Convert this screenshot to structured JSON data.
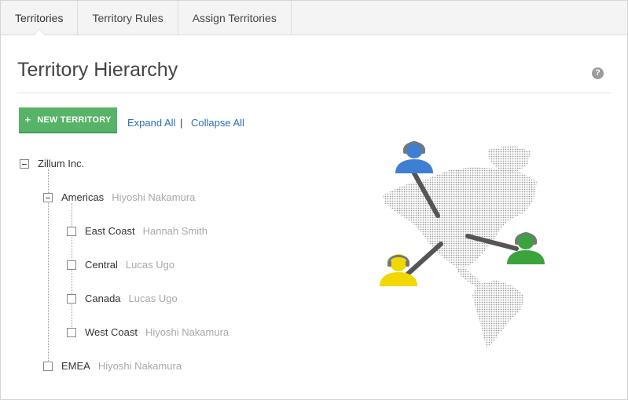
{
  "tabs": [
    {
      "label": "Territories",
      "active": true
    },
    {
      "label": "Territory Rules",
      "active": false
    },
    {
      "label": "Assign Territories",
      "active": false
    }
  ],
  "header": {
    "title": "Territory Hierarchy",
    "help_icon": "question-mark-icon",
    "help_glyph": "?"
  },
  "toolbar": {
    "new_label": "NEW TERRITORY",
    "new_icon": "+",
    "expand_all": "Expand All",
    "separator": "|",
    "collapse_all": "Collapse All",
    "button_color": "#56b367",
    "link_color": "#2a6ebb"
  },
  "tree": {
    "root": {
      "name": "Zillum Inc.",
      "state": "expanded"
    },
    "americas": {
      "name": "Americas",
      "owner": "Hiyoshi Nakamura",
      "state": "expanded"
    },
    "east_coast": {
      "name": "East Coast",
      "owner": "Hannah Smith"
    },
    "central": {
      "name": "Central",
      "owner": "Lucas Ugo"
    },
    "canada": {
      "name": "Canada",
      "owner": "Lucas Ugo"
    },
    "west_coast": {
      "name": "West Coast",
      "owner": "Hiyoshi Nakamura"
    },
    "emea": {
      "name": "EMEA",
      "owner": "Hiyoshi Nakamura",
      "state": "collapsed"
    }
  },
  "illustration": {
    "agents": [
      {
        "color": "#3f7fd3",
        "icon": "headset-agent-icon"
      },
      {
        "color": "#3ca33c",
        "icon": "headset-agent-icon"
      },
      {
        "color": "#f1d800",
        "icon": "headset-agent-icon"
      }
    ],
    "map_icon": "dotted-americas-map-icon"
  }
}
